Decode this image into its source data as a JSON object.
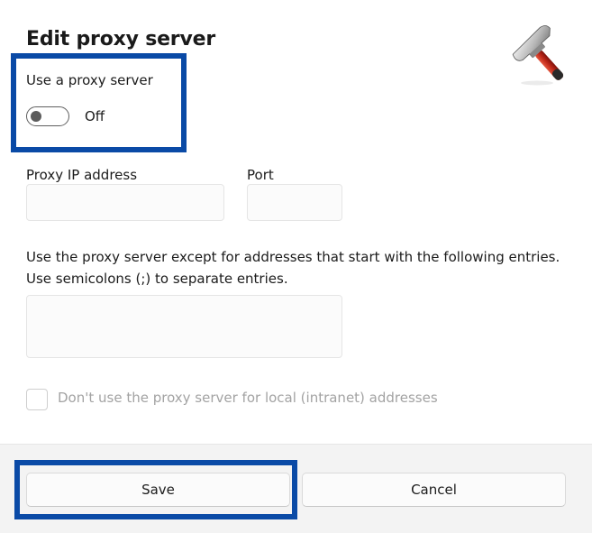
{
  "dialog": {
    "title": "Edit proxy server",
    "logo_icon": "hammer-icon"
  },
  "proxy_toggle": {
    "label": "Use a proxy server",
    "state_text": "Off",
    "enabled": false
  },
  "fields": {
    "ip_label": "Proxy IP address",
    "ip_value": "",
    "port_label": "Port",
    "port_value": "",
    "exceptions_description": "Use the proxy server except for addresses that start with the following entries. Use semicolons (;) to separate entries.",
    "exceptions_value": ""
  },
  "local_bypass": {
    "label": "Don't use the proxy server for local (intranet) addresses",
    "checked": false,
    "disabled": true
  },
  "buttons": {
    "save_label": "Save",
    "cancel_label": "Cancel"
  },
  "colors": {
    "highlight_border": "#0a4aa6",
    "footer_background": "#f3f3f3",
    "disabled_text": "#a3a3a3"
  }
}
